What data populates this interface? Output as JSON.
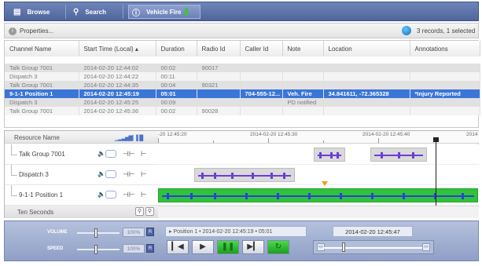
{
  "tabs": {
    "browse": "Browse",
    "search": "Search",
    "vehicle": "Vehicle Fire"
  },
  "properties": {
    "label": "Properties...",
    "record_count": "3 records, 1 selected"
  },
  "table": {
    "headers": [
      "Channel Name",
      "Start Time (Local) ▴",
      "Duration",
      "Radio Id",
      "Caller Id",
      "Note",
      "Location",
      "Annotations"
    ],
    "rows": [
      {
        "style": "gray",
        "cells": [
          "Talk Group 7001",
          "2014-02-20 12:44:02",
          "00:02",
          "90017",
          "",
          "",
          "",
          ""
        ]
      },
      {
        "style": "white",
        "cells": [
          "Dispatch 3",
          "2014-02-20 12:44:22",
          "00:11",
          "",
          "",
          "",
          "",
          ""
        ]
      },
      {
        "style": "gray",
        "cells": [
          "Talk Group 7001",
          "2014-02-20 12:44:35",
          "00:04",
          "90321",
          "",
          "",
          "",
          ""
        ]
      },
      {
        "style": "sel",
        "cells": [
          "9-1-1 Position 1",
          "2014-02-20 12:45:19",
          "05:01",
          "",
          "704-555-12...",
          "Veh. Fire",
          "34.841611, -72.365328",
          "*Injury Reported"
        ]
      },
      {
        "style": "gray",
        "cells": [
          "Dispatch 3",
          "2014-02-20 12:45:25",
          "00:09",
          "",
          "",
          "PD notified",
          "",
          ""
        ]
      },
      {
        "style": "white",
        "cells": [
          "Talk Group 7001",
          "2014-02-20 12:45:36",
          "00:02",
          "90028",
          "",
          "",
          "",
          ""
        ]
      }
    ]
  },
  "timeline": {
    "resource_header": "Resource Name",
    "ruler_labels": [
      "-20 12:45:20",
      "2014-02-20 12:45:30",
      "2014-02-20 12:45:40",
      "2014"
    ],
    "resources": [
      "Talk Group 7001",
      "Dispatch 3",
      "9-1-1 Position 1"
    ],
    "zoom_label": "Ten Seconds"
  },
  "player": {
    "volume_label": "VOLUME",
    "speed_label": "SPEED",
    "volume_pct": "100%",
    "speed_pct": "100%",
    "reset": "R",
    "now_playing": "Position 1 • 2014-02-20 12:45:19 • 05:01",
    "current_time": "2014-02-20 12:45:47",
    "scrub_back": "<<",
    "scrub_fwd": ">>"
  }
}
